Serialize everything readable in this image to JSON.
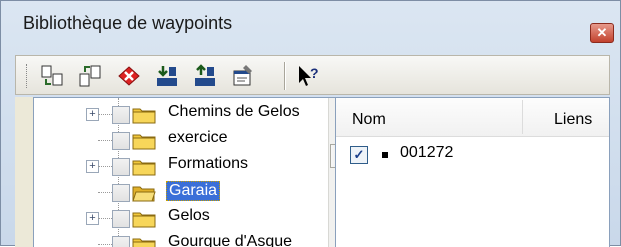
{
  "window": {
    "title": "Bibliothèque de waypoints",
    "close_glyph": "✕"
  },
  "toolbar": {
    "buttons": [
      {
        "name": "copy-waypoint-icon"
      },
      {
        "name": "paste-waypoint-icon"
      },
      {
        "name": "delete-icon"
      },
      {
        "name": "import-icon"
      },
      {
        "name": "export-icon"
      },
      {
        "name": "properties-icon"
      },
      {
        "name": "context-help-icon"
      }
    ]
  },
  "tree": {
    "items": [
      {
        "label": "Chemins de Gelos",
        "expandable": true,
        "expander": "+",
        "selected": false,
        "folder": "closed"
      },
      {
        "label": "exercice",
        "expandable": false,
        "expander": "",
        "selected": false,
        "folder": "closed"
      },
      {
        "label": "Formations",
        "expandable": true,
        "expander": "+",
        "selected": false,
        "folder": "closed"
      },
      {
        "label": "Garaia",
        "expandable": false,
        "expander": "",
        "selected": true,
        "folder": "open"
      },
      {
        "label": "Gelos",
        "expandable": true,
        "expander": "+",
        "selected": false,
        "folder": "closed"
      },
      {
        "label": "Gourgue d'Asque",
        "expandable": false,
        "expander": "",
        "selected": false,
        "folder": "closed"
      }
    ],
    "scroll_up_glyph": "▲"
  },
  "list": {
    "columns": [
      "Nom",
      "Liens"
    ],
    "rows": [
      {
        "checked": true,
        "check_glyph": "✓",
        "name": "001272",
        "links": ""
      }
    ]
  },
  "colors": {
    "selection": "#3a6fd8",
    "folder": "#f2c83b"
  }
}
